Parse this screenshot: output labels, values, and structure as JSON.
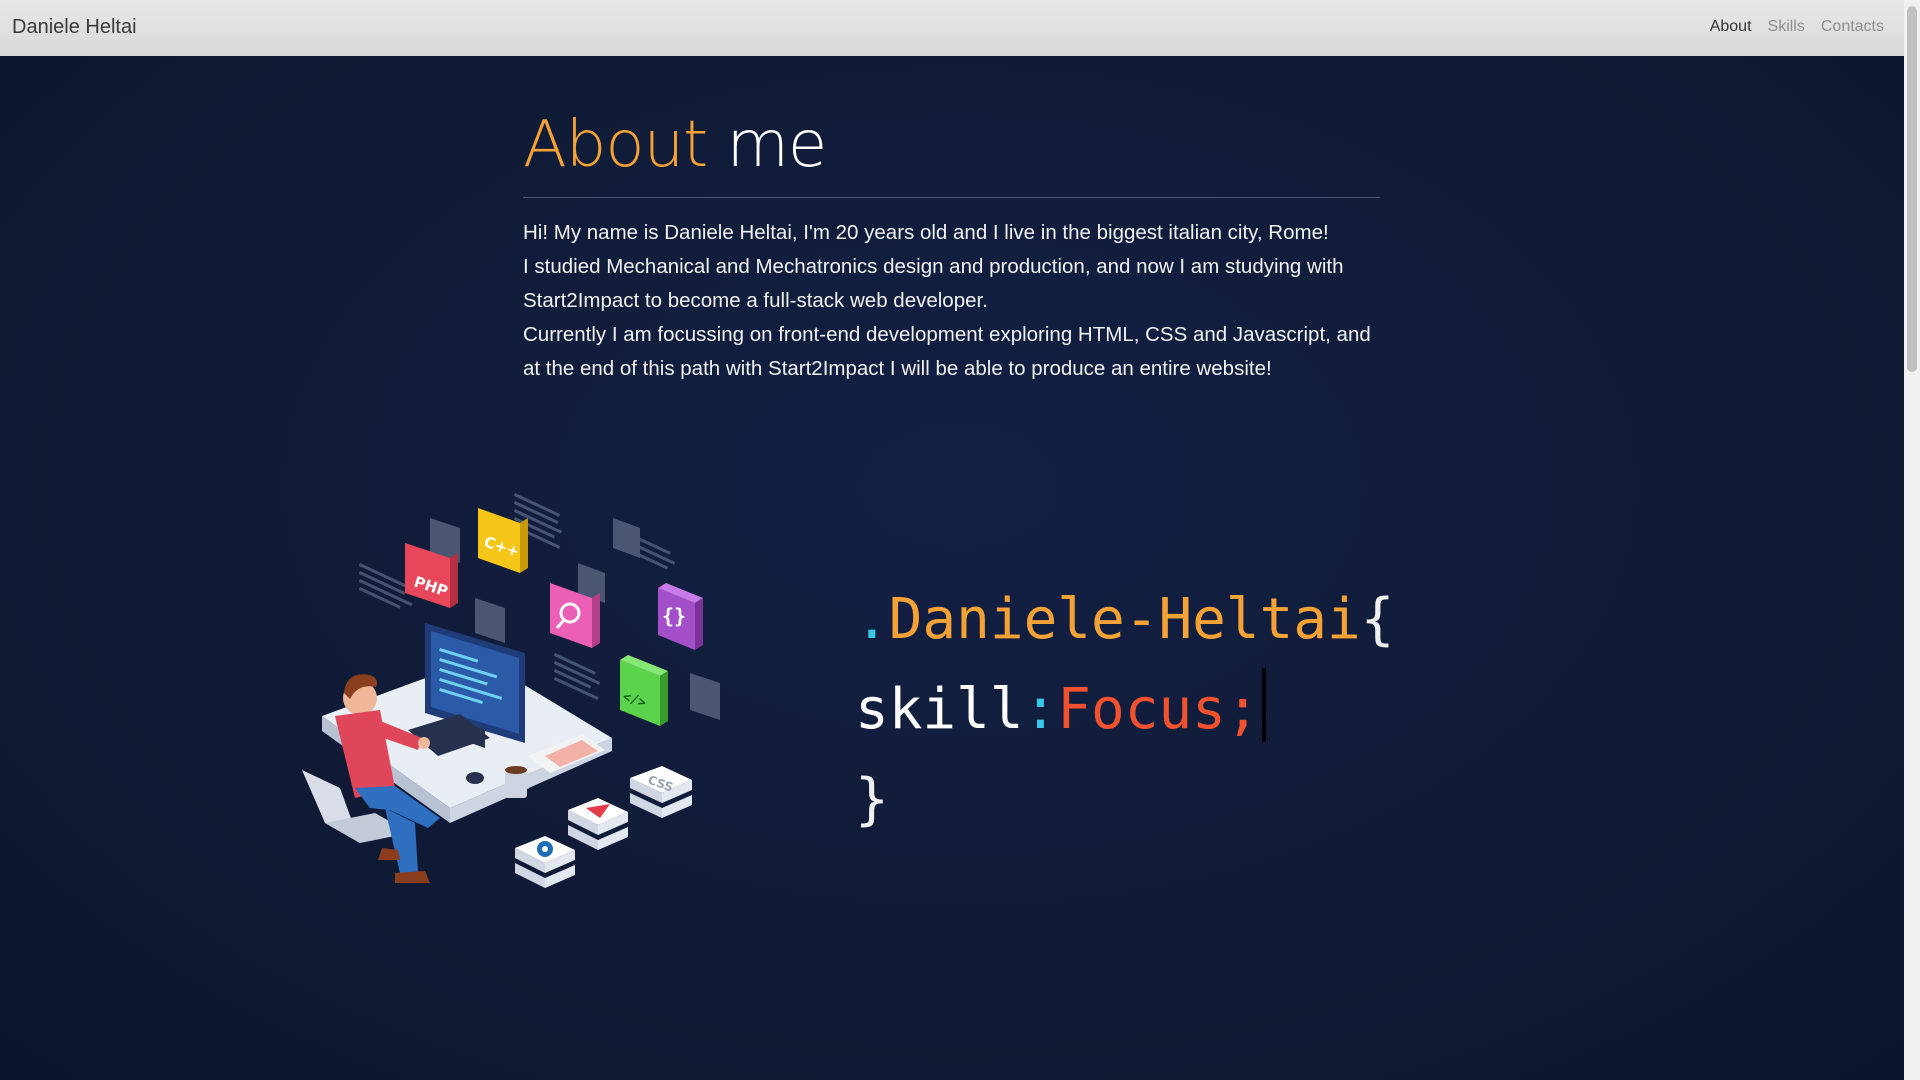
{
  "navbar": {
    "brand": "Daniele Heltai",
    "links": [
      "About",
      "Skills",
      "Contacts"
    ],
    "active": "About"
  },
  "about": {
    "title_accent": "About",
    "title_rest": "me",
    "paragraphs": [
      "Hi! My name is Daniele Heltai, I'm 20 years old and I live in the biggest italian city, Rome!",
      "I studied Mechanical and Mechatronics design and production, and now I am studying with Start2Impact to become a full-stack web developer.",
      "Currently I am focussing on front-end development exploring HTML, CSS and Javascript, and at the end of this path with Start2Impact I will be able to produce an entire website!"
    ]
  },
  "illustration": {
    "tiles": [
      "PHP",
      "C++",
      "{}",
      "</>",
      "CSS"
    ]
  },
  "code": {
    "dot": ".",
    "class_name": "Daniele-Heltai",
    "open_brace": "{",
    "property": "skill",
    "colon": ":",
    "value": "Focus;",
    "close_brace": "}"
  },
  "colors": {
    "accent": "#f4a236",
    "cyan": "#39c7e6",
    "red": "#f0522f",
    "background": "#111c39"
  }
}
